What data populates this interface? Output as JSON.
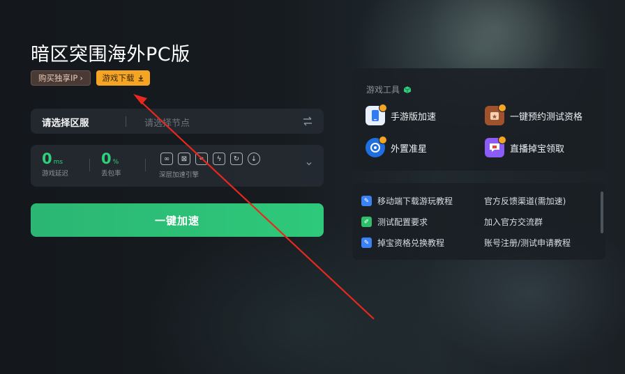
{
  "header": {
    "title": "暗区突围海外PC版",
    "buy_ip_label": "购买独享IP",
    "download_label": "游戏下载"
  },
  "server": {
    "label": "请选择区服",
    "placeholder": "请选择节点"
  },
  "stats": {
    "latency_value": "0",
    "latency_unit": "ms",
    "latency_label": "游戏延迟",
    "loss_value": "0",
    "loss_unit": "%",
    "loss_label": "丢包率",
    "deep_label": "深层加速引擎"
  },
  "accelerate_label": "一键加速",
  "tools": {
    "title": "游戏工具",
    "items": [
      {
        "label": "手游版加速",
        "icon": "phone-icon"
      },
      {
        "label": "一键预约测试资格",
        "icon": "reservation-icon"
      },
      {
        "label": "外置准星",
        "icon": "crosshair-icon"
      },
      {
        "label": "直播掉宝领取",
        "icon": "live-gift-icon"
      }
    ]
  },
  "links": {
    "items": [
      {
        "label": "移动端下载游玩教程"
      },
      {
        "label": "官方反馈渠道(需加速)"
      },
      {
        "label": "测试配置要求"
      },
      {
        "label": "加入官方交流群"
      },
      {
        "label": "掉宝资格兑换教程"
      },
      {
        "label": "账号注册/测试申请教程"
      }
    ]
  },
  "colors": {
    "accent_green": "#2ec97a",
    "download_orange": "#f5a524",
    "annotation_arrow": "#e8281e"
  }
}
